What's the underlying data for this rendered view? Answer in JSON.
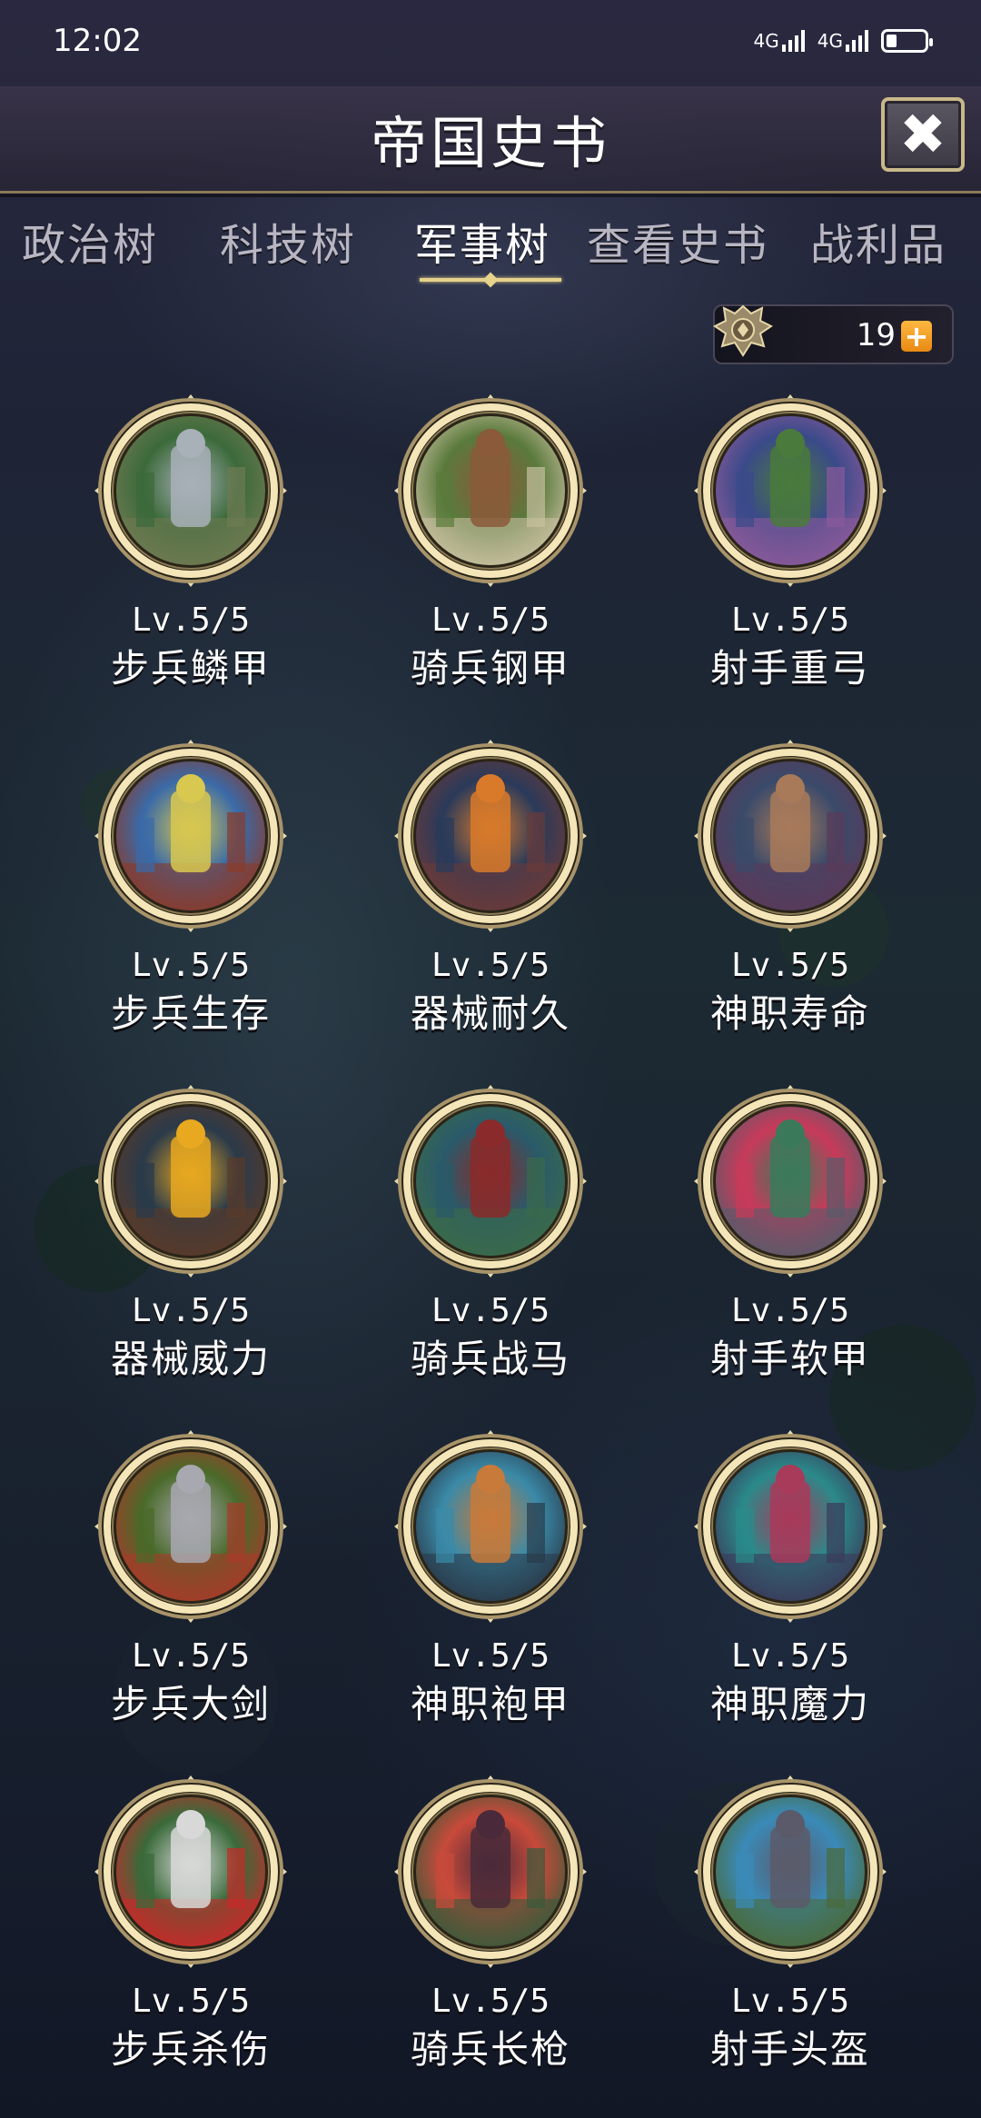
{
  "status": {
    "time": "12:02",
    "signal1": "4G",
    "signal2": "4G"
  },
  "header": {
    "title": "帝国史书"
  },
  "tabs": [
    "政治树",
    "科技树",
    "军事树",
    "查看史书",
    "战利品"
  ],
  "active_tab": "军事树",
  "points": {
    "value": "19"
  },
  "skills": [
    {
      "level": "Lv.5/5",
      "name": "步兵鳞甲",
      "colors": [
        "#3c6a3a",
        "#a8b0b8",
        "#6e7a52"
      ]
    },
    {
      "level": "Lv.5/5",
      "name": "骑兵钢甲",
      "colors": [
        "#5a7a3c",
        "#8a5a3a",
        "#c8c0a0"
      ]
    },
    {
      "level": "Lv.5/5",
      "name": "射手重弓",
      "colors": [
        "#3a4a8a",
        "#4a7a3c",
        "#8a5a9a"
      ]
    },
    {
      "level": "Lv.5/5",
      "name": "步兵生存",
      "colors": [
        "#3a6aa8",
        "#d8c850",
        "#8a3a2a"
      ]
    },
    {
      "level": "Lv.5/5",
      "name": "器械耐久",
      "colors": [
        "#2a3a5a",
        "#d87a2a",
        "#6a3a3a"
      ]
    },
    {
      "level": "Lv.5/5",
      "name": "神职寿命",
      "colors": [
        "#3a4a6a",
        "#a87a5a",
        "#5a3a5a"
      ]
    },
    {
      "level": "Lv.5/5",
      "name": "器械威力",
      "colors": [
        "#2a3a4a",
        "#e8a820",
        "#5a3a2a"
      ]
    },
    {
      "level": "Lv.5/5",
      "name": "骑兵战马",
      "colors": [
        "#2a5a6a",
        "#8a2a2a",
        "#3a6a4a"
      ]
    },
    {
      "level": "Lv.5/5",
      "name": "射手软甲",
      "colors": [
        "#c83a5a",
        "#3a7a5a",
        "#5a5a6a"
      ]
    },
    {
      "level": "Lv.5/5",
      "name": "步兵大剑",
      "colors": [
        "#4a6a2a",
        "#a8a8b0",
        "#a83a2a"
      ]
    },
    {
      "level": "Lv.5/5",
      "name": "神职袍甲",
      "colors": [
        "#3a8aa8",
        "#c87a3a",
        "#2a3a4a"
      ]
    },
    {
      "level": "Lv.5/5",
      "name": "神职魔力",
      "colors": [
        "#2a8a8a",
        "#a83a5a",
        "#3a3a5a"
      ]
    },
    {
      "level": "Lv.5/5",
      "name": "步兵杀伤",
      "colors": [
        "#3a6a3a",
        "#d8d8d8",
        "#c82a2a"
      ]
    },
    {
      "level": "Lv.5/5",
      "name": "骑兵长枪",
      "colors": [
        "#c84a3a",
        "#4a2a3a",
        "#3a5a3a"
      ]
    },
    {
      "level": "Lv.5/5",
      "name": "射手头盔",
      "colors": [
        "#3a8ab8",
        "#5a5a6a",
        "#4a6a3a"
      ]
    }
  ],
  "theme": {
    "gold": "#e6d28a",
    "accent_orange": "#f0a020"
  }
}
